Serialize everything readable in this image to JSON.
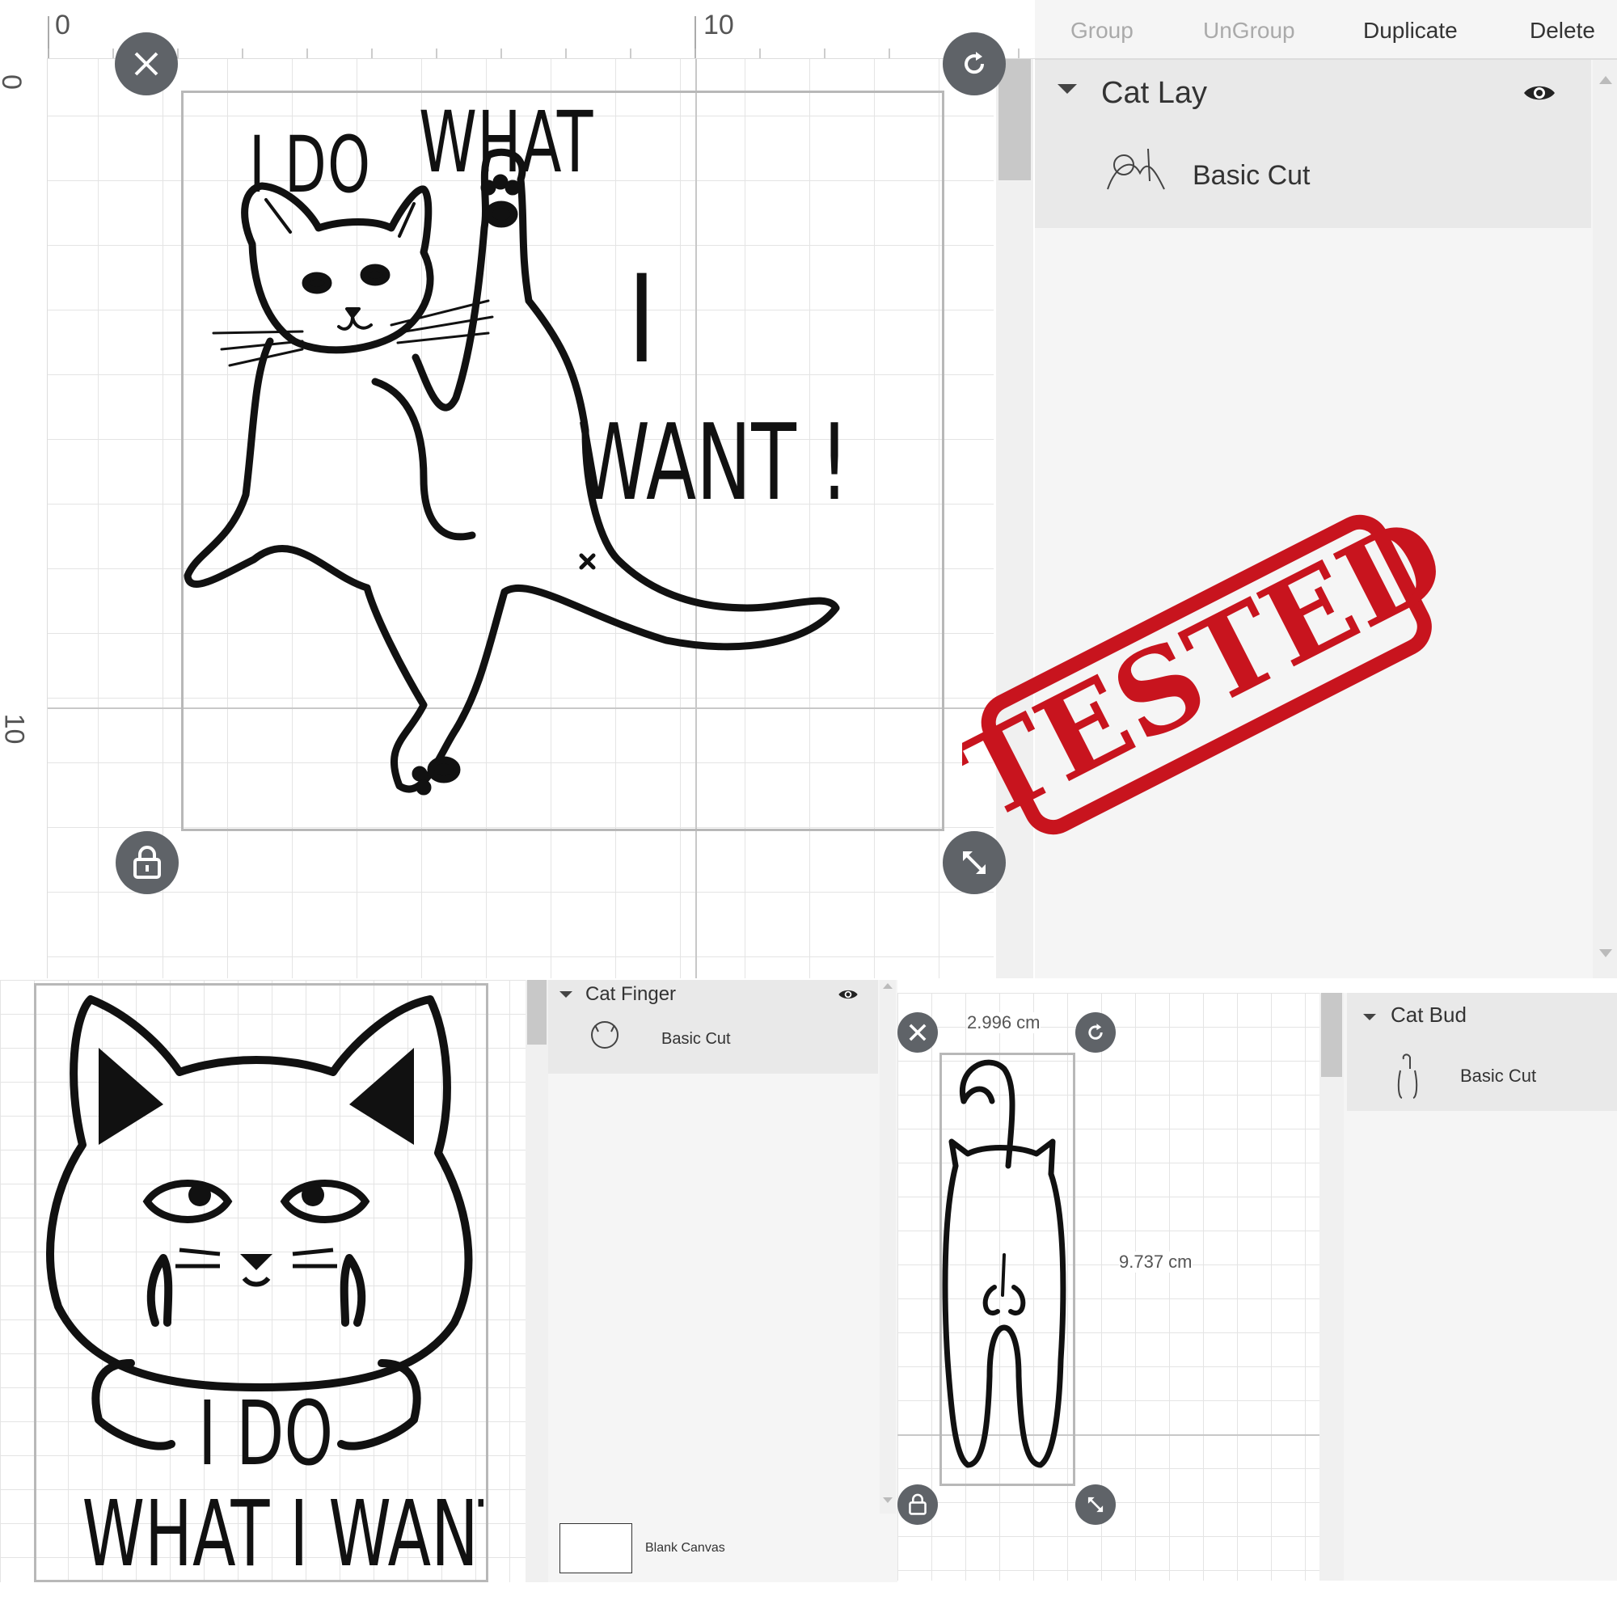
{
  "toolbar": {
    "group": "Group",
    "ungroup": "UnGroup",
    "duplicate": "Duplicate",
    "delete": "Delete"
  },
  "rulers": {
    "h_zero": "0",
    "h_ten": "10",
    "v_zero": "0",
    "v_ten": "10"
  },
  "panel_top": {
    "layer_name": "Cat Lay",
    "sub_label": "Basic Cut",
    "visibility_icon": "eye-icon"
  },
  "stamp": {
    "text": "TESTED",
    "color": "#c8141e"
  },
  "panel_middle": {
    "layer_name": "Cat Finger",
    "sub_label": "Basic Cut",
    "blank_canvas": "Blank Canvas"
  },
  "bud_canvas": {
    "width_label": "2.996 cm",
    "height_label": "9.737 cm"
  },
  "panel_right": {
    "layer_name": "Cat Bud",
    "sub_label": "Basic Cut"
  },
  "design_lay": {
    "line1a": "I DO",
    "line1b": "WHAT",
    "line2": "I",
    "line3": "WANT !"
  },
  "design_finger": {
    "line1": "I DO",
    "line2": "WHAT I WANT"
  },
  "colors": {
    "accent_icon": "#5f6368",
    "panel": "#f5f5f5",
    "layer_row": "#e9e9e9"
  }
}
